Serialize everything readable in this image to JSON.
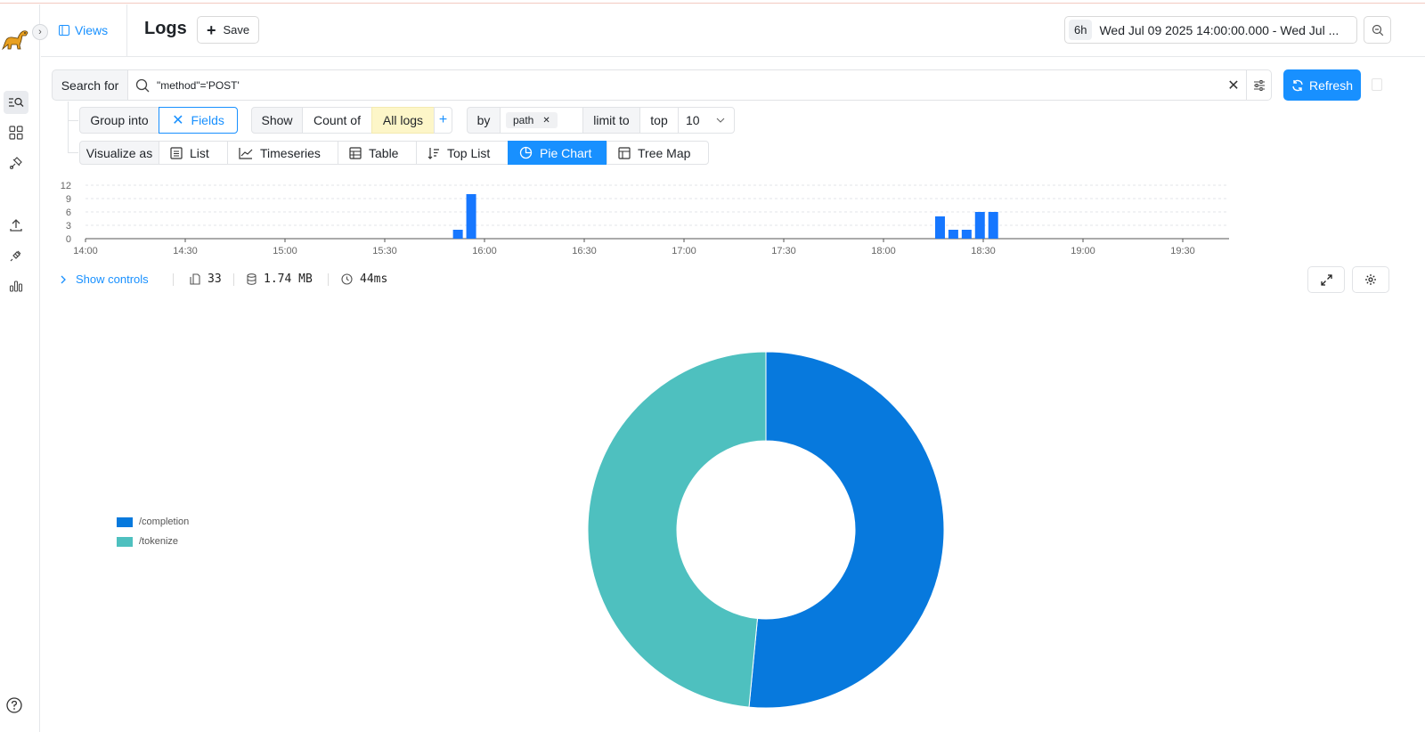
{
  "header": {
    "views_label": "Views",
    "title": "Logs",
    "save_label": "Save",
    "time_preset": "6h",
    "time_range": "Wed Jul 09 2025 14:00:00.000 - Wed Jul ..."
  },
  "search": {
    "label": "Search for",
    "query": "\"method\"='POST'",
    "refresh_label": "Refresh"
  },
  "group": {
    "label": "Group into",
    "fields_label": "Fields",
    "show_label": "Show",
    "count_of_label": "Count of",
    "all_logs_label": "All logs",
    "add_symbol": "+",
    "by_label": "by",
    "by_tag": "path",
    "limit_label": "limit to",
    "top_label": "top",
    "top_value": "10"
  },
  "visualize": {
    "label": "Visualize as",
    "options": [
      "List",
      "Timeseries",
      "Table",
      "Top List",
      "Pie Chart",
      "Tree Map"
    ],
    "active": "Pie Chart"
  },
  "histogram": {
    "y_ticks": [
      "12",
      "9",
      "6",
      "3",
      "0"
    ],
    "x_ticks": [
      "14:00",
      "14:30",
      "15:00",
      "15:30",
      "16:00",
      "16:30",
      "17:00",
      "17:30",
      "18:00",
      "18:30",
      "19:00",
      "19:30"
    ],
    "color": "#1677ff"
  },
  "info": {
    "show_controls": "Show controls",
    "count": "33",
    "size": "1.74 MB",
    "duration": "44ms"
  },
  "chart_data": [
    {
      "type": "bar",
      "x": [
        "15:52",
        "15:56",
        "18:17",
        "18:21",
        "18:25",
        "18:29",
        "18:33"
      ],
      "values": [
        2,
        10,
        5,
        2,
        2,
        6,
        6
      ],
      "ylim": [
        0,
        12
      ],
      "xlim": [
        "14:00",
        "19:55"
      ]
    },
    {
      "type": "pie",
      "labels": [
        "/completion",
        "/tokenize"
      ],
      "values": [
        17,
        16
      ],
      "colors": [
        "#0779dd",
        "#4ec0bf"
      ],
      "legend_position": "left"
    }
  ]
}
